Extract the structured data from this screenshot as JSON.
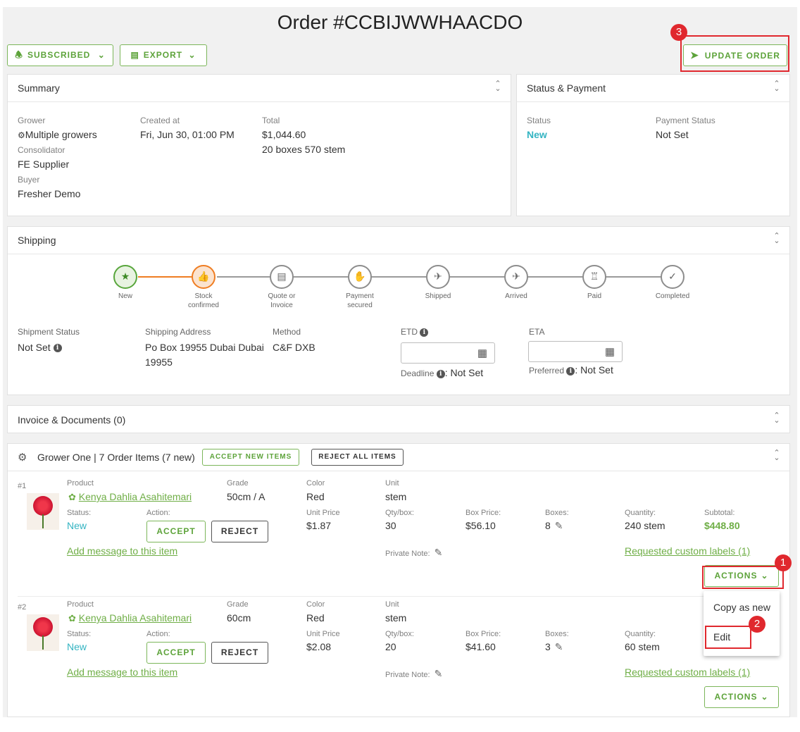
{
  "title": "Order #CCBIJWWHAACDO",
  "toolbar": {
    "subscribed_label": "SUBSCRIBED",
    "export_label": "EXPORT",
    "update_label": "UPDATE ORDER"
  },
  "annotations": [
    "1",
    "2",
    "3"
  ],
  "summary": {
    "title": "Summary",
    "grower_label": "Grower",
    "grower_value": "Multiple growers",
    "consolidator_label": "Consolidator",
    "consolidator_value": "FE Supplier",
    "buyer_label": "Buyer",
    "buyer_value": "Fresher Demo",
    "created_label": "Created at",
    "created_value": "Fri, Jun 30, 01:00 PM",
    "total_label": "Total",
    "total_value": "$1,044.60",
    "total_sub": "20 boxes 570 stem"
  },
  "status_payment": {
    "title": "Status & Payment",
    "status_label": "Status",
    "status_value": "New",
    "payment_label": "Payment Status",
    "payment_value": "Not Set"
  },
  "shipping": {
    "title": "Shipping",
    "steps": [
      {
        "l1": "New",
        "l2": "",
        "icon": "star-icon",
        "state": "done"
      },
      {
        "l1": "Stock",
        "l2": "confirmed",
        "icon": "thumbs-up-icon",
        "state": "current"
      },
      {
        "l1": "Quote or",
        "l2": "Invoice",
        "icon": "document-icon",
        "state": "todo"
      },
      {
        "l1": "Payment",
        "l2": "secured",
        "icon": "payment-hand-icon",
        "state": "todo"
      },
      {
        "l1": "Shipped",
        "l2": "",
        "icon": "plane-takeoff-icon",
        "state": "todo"
      },
      {
        "l1": "Arrived",
        "l2": "",
        "icon": "plane-landing-icon",
        "state": "todo"
      },
      {
        "l1": "Paid",
        "l2": "",
        "icon": "money-icon",
        "state": "todo"
      },
      {
        "l1": "Completed",
        "l2": "",
        "icon": "check-icon",
        "state": "todo"
      }
    ],
    "shipment_status_label": "Shipment Status",
    "shipment_status_value": "Not Set",
    "address_label": "Shipping Address",
    "address_line1": "Po Box 19955 Dubai Dubai",
    "address_line2": "19955",
    "method_label": "Method",
    "method_value": "C&F DXB",
    "etd_label": "ETD",
    "eta_label": "ETA",
    "deadline_label": "Deadline",
    "deadline_value": ": Not Set",
    "preferred_label": "Preferred",
    "preferred_value": ": Not Set"
  },
  "invoice": {
    "title": "Invoice & Documents (0)"
  },
  "grower_section": {
    "title": "Grower One | 7 Order Items (7 new)",
    "accept_all_label": "ACCEPT NEW ITEMS",
    "reject_all_label": "REJECT ALL ITEMS"
  },
  "labels": {
    "product": "Product",
    "grade": "Grade",
    "color": "Color",
    "unit": "Unit",
    "status": "Status:",
    "action": "Action:",
    "unit_price": "Unit Price",
    "qty_box": "Qty/box:",
    "box_price": "Box Price:",
    "boxes": "Boxes:",
    "quantity": "Quantity:",
    "subtotal": "Subtotal:",
    "add_message": "Add message to this item",
    "private_note": "Private Note:",
    "custom_labels": "Requested custom labels (1)",
    "accept": "ACCEPT",
    "reject": "REJECT",
    "actions": "ACTIONS"
  },
  "items": [
    {
      "num": "#1",
      "product": "Kenya Dahlia Asahitemari",
      "grade": "50cm / A",
      "color": "Red",
      "unit": "stem",
      "status": "New",
      "unit_price": "$1.87",
      "qty_box": "30",
      "box_price": "$56.10",
      "boxes": "8",
      "quantity": "240 stem",
      "subtotal": "$448.80"
    },
    {
      "num": "#2",
      "product": "Kenya Dahlia Asahitemari",
      "grade": "60cm",
      "color": "Red",
      "unit": "stem",
      "status": "New",
      "unit_price": "$2.08",
      "qty_box": "20",
      "box_price": "$41.60",
      "boxes": "3",
      "quantity": "60 stem",
      "subtotal": ""
    }
  ],
  "dropdown": {
    "copy_label": "Copy as new",
    "edit_label": "Edit"
  }
}
